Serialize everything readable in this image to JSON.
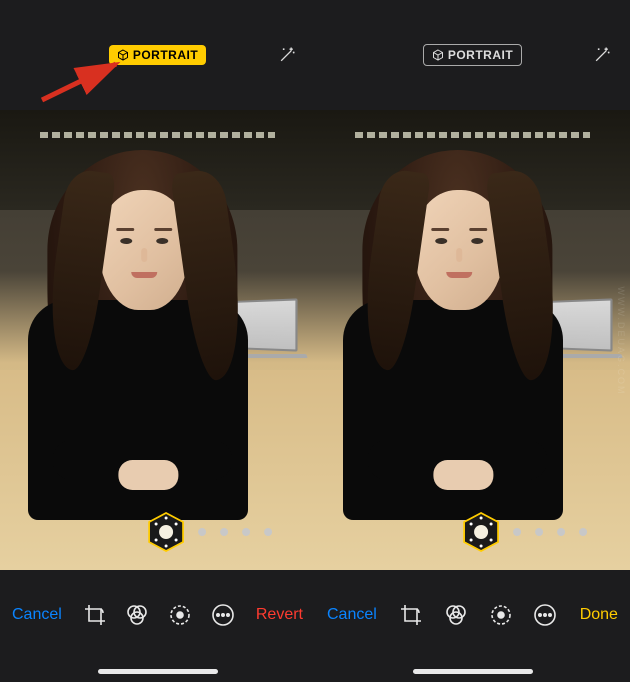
{
  "panes": [
    {
      "badge": {
        "label": "PORTRAIT",
        "active": true
      },
      "toolbar": {
        "cancel_label": "Cancel",
        "revert_label": "Revert"
      }
    },
    {
      "badge": {
        "label": "PORTRAIT",
        "active": false
      },
      "toolbar": {
        "cancel_label": "Cancel",
        "done_label": "Done"
      }
    }
  ],
  "lighting_picker": {
    "dots_count": 4
  },
  "watermark": "WWW.DEUAG.COM"
}
